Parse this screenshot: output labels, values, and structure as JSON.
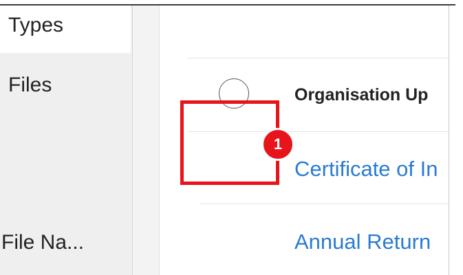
{
  "sidebar": {
    "items": [
      {
        "label": "Types"
      },
      {
        "label": "Files"
      },
      {
        "label": "File Na..."
      }
    ]
  },
  "table": {
    "header": "Organisation Up",
    "rows": [
      {
        "name": "Certificate of In"
      },
      {
        "name": "Annual Return"
      }
    ]
  },
  "annotation": {
    "badge": "1",
    "color": "#e8141c"
  }
}
